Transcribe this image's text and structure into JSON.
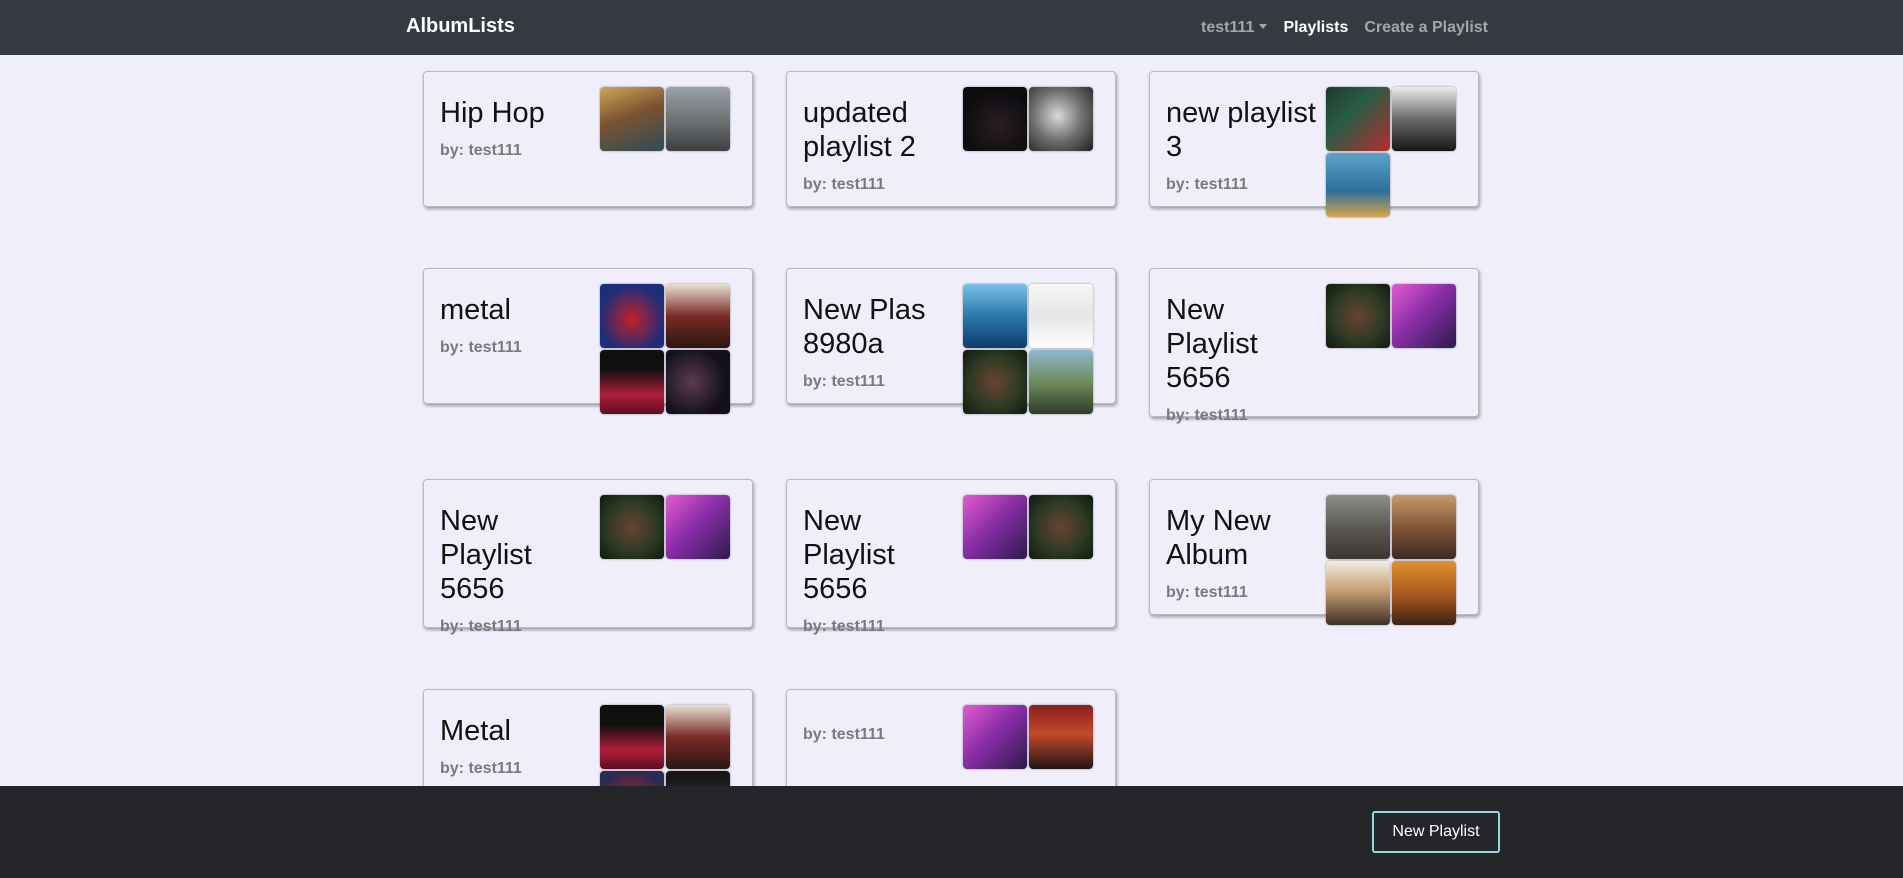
{
  "navbar": {
    "brand": "AlbumLists",
    "user": "test111",
    "playlists": "Playlists",
    "create": "Create a Playlist"
  },
  "playlists": [
    {
      "title": "Hip Hop",
      "author": "by: test111",
      "covers": [
        "album-cover",
        "album-cover"
      ]
    },
    {
      "title": "updated playlist 2",
      "author": "by: test111",
      "covers": [
        "album-cover",
        "album-cover"
      ]
    },
    {
      "title": "new playlist 3",
      "author": "by: test111",
      "covers": [
        "album-cover",
        "album-cover",
        "album-cover"
      ]
    },
    {
      "title": "metal",
      "author": "by: test111",
      "covers": [
        "album-cover",
        "album-cover",
        "album-cover",
        "album-cover"
      ]
    },
    {
      "title": "New Plas 8980a",
      "author": "by: test111",
      "covers": [
        "album-cover",
        "album-cover",
        "album-cover",
        "album-cover"
      ]
    },
    {
      "title": "New Playlist 5656",
      "author": "by: test111",
      "covers": [
        "album-cover",
        "album-cover"
      ]
    },
    {
      "title": "New Playlist 5656",
      "author": "by: test111",
      "covers": [
        "album-cover",
        "album-cover"
      ]
    },
    {
      "title": "New Playlist 5656",
      "author": "by: test111",
      "covers": [
        "album-cover",
        "album-cover"
      ]
    },
    {
      "title": "My New Album",
      "author": "by: test111",
      "covers": [
        "album-cover",
        "album-cover",
        "album-cover",
        "album-cover"
      ]
    },
    {
      "title": "Metal",
      "author": "by: test111",
      "covers": [
        "album-cover",
        "album-cover",
        "album-cover",
        "album-cover"
      ]
    },
    {
      "title": "",
      "author": "by: test111",
      "covers": [
        "album-cover",
        "album-cover"
      ]
    }
  ],
  "footer": {
    "new_playlist": "New Playlist"
  }
}
